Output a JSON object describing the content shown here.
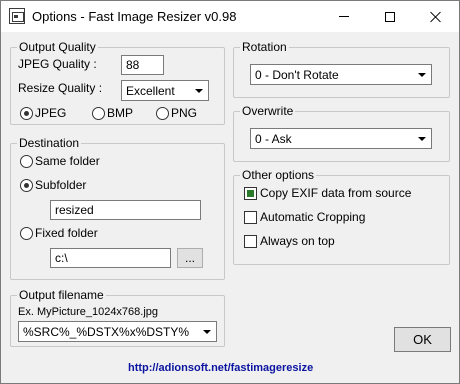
{
  "window": {
    "title": "Options - Fast Image Resizer v0.98",
    "icons": {
      "app": "app-icon",
      "minimize": "minimize-icon",
      "maximize": "maximize-icon",
      "close": "close-icon"
    }
  },
  "output_quality": {
    "title": "Output Quality",
    "jpeg_quality_label": "JPEG Quality :",
    "jpeg_quality_value": "88",
    "resize_quality_label": "Resize Quality :",
    "resize_quality_value": "Excellent",
    "formats": [
      {
        "label": "JPEG",
        "selected": true
      },
      {
        "label": "BMP",
        "selected": false
      },
      {
        "label": "PNG",
        "selected": false
      }
    ]
  },
  "destination": {
    "title": "Destination",
    "same_folder_label": "Same folder",
    "same_folder_selected": false,
    "subfolder_label": "Subfolder",
    "subfolder_selected": true,
    "subfolder_value": "resized",
    "fixed_folder_label": "Fixed folder",
    "fixed_folder_selected": false,
    "fixed_folder_value": "c:\\",
    "browse_label": "..."
  },
  "output_filename": {
    "title": "Output filename",
    "example": "Ex. MyPicture_1024x768.jpg",
    "pattern_value": "%SRC%_%DSTX%x%DSTY%"
  },
  "rotation": {
    "title": "Rotation",
    "value": "0 - Don't Rotate"
  },
  "overwrite": {
    "title": "Overwrite",
    "value": "0 - Ask"
  },
  "other_options": {
    "title": "Other options",
    "items": [
      {
        "label": "Copy EXIF data from source",
        "checked": true
      },
      {
        "label": "Automatic Cropping",
        "checked": false
      },
      {
        "label": "Always on top",
        "checked": false
      }
    ]
  },
  "ok_label": "OK",
  "link_text": "http://adionsoft.net/fastimageresize",
  "colors": {
    "link": "#0a14a0",
    "check_fill": "#2a7a2a",
    "window_bg": "#f0f0f0"
  }
}
